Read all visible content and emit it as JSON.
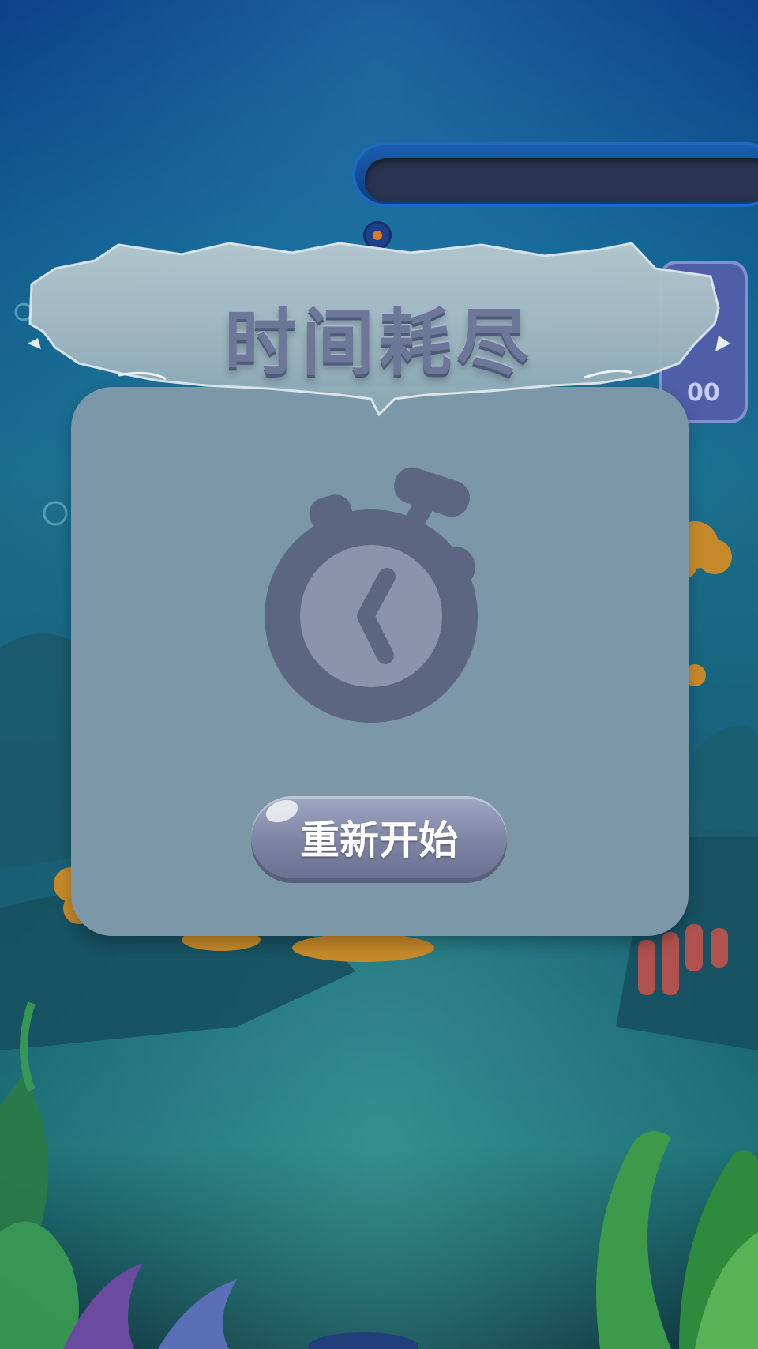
{
  "dialog": {
    "title": "时间耗尽",
    "restart_label": "重新开始"
  },
  "hud": {
    "side_counter_text": "00"
  },
  "icons": {
    "timer": "stopwatch-icon"
  },
  "colors": {
    "modal_bg": "#7c97a8",
    "button_bg": "#8a90ae",
    "title_text": "#6d7898",
    "ocean_top": "#0b3f7a"
  }
}
